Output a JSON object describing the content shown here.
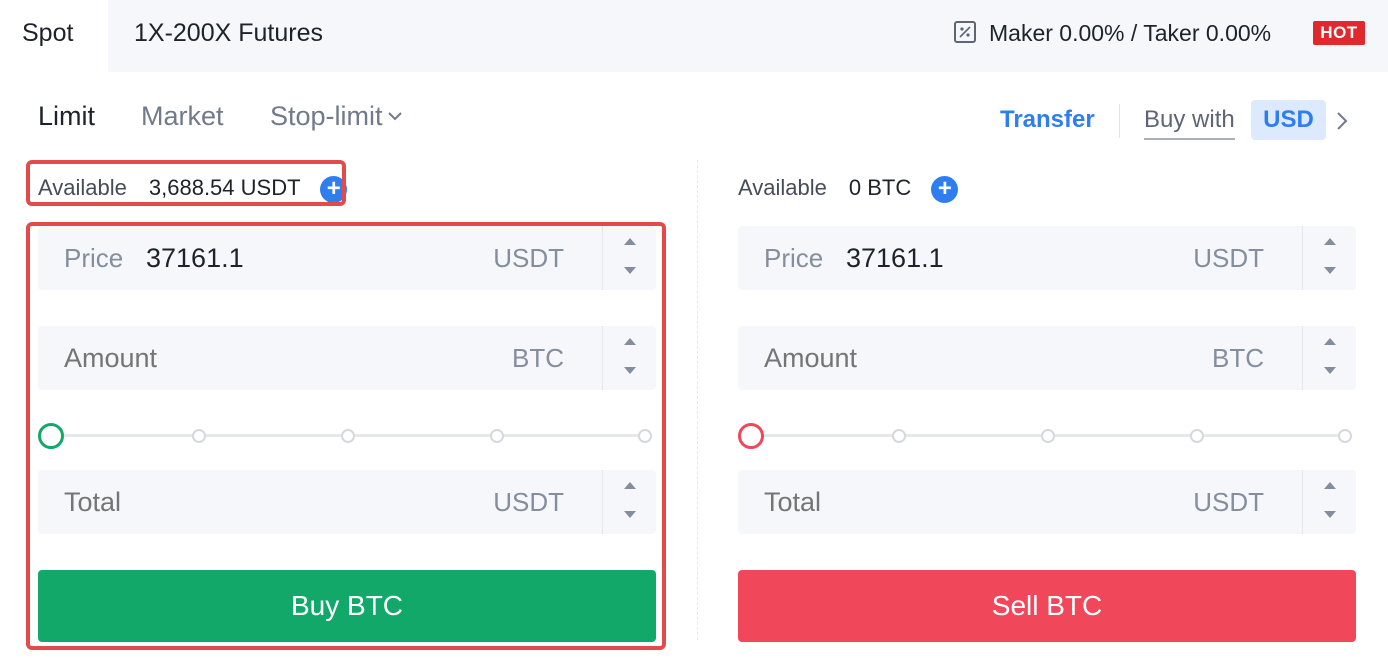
{
  "header": {
    "spot_tab": "Spot",
    "futures_tab": "1X-200X Futures",
    "fee_text": "Maker 0.00% / Taker 0.00%",
    "hot_badge": "HOT",
    "fee_icon": "percent-icon"
  },
  "order_types": {
    "limit": "Limit",
    "market": "Market",
    "stop_limit": "Stop-limit",
    "active": "Limit"
  },
  "toolbar": {
    "transfer": "Transfer",
    "buy_with": "Buy with",
    "currency": "USD"
  },
  "buy": {
    "available_label": "Available",
    "available_value": "3,688.54 USDT",
    "price_label": "Price",
    "price_value": "37161.1",
    "price_unit": "USDT",
    "amount_label": "Amount",
    "amount_unit": "BTC",
    "total_label": "Total",
    "total_unit": "USDT",
    "slider_percent": 0,
    "button": "Buy BTC"
  },
  "sell": {
    "available_label": "Available",
    "available_value": "0 BTC",
    "price_label": "Price",
    "price_value": "37161.1",
    "price_unit": "USDT",
    "amount_label": "Amount",
    "amount_unit": "BTC",
    "total_label": "Total",
    "total_unit": "USDT",
    "slider_percent": 0,
    "button": "Sell BTC"
  },
  "colors": {
    "buy_green": "#12a86a",
    "sell_red": "#f0475b",
    "accent_blue": "#2f7ef0",
    "highlight_red": "#e34a4a",
    "hot_red": "#e0282e"
  }
}
